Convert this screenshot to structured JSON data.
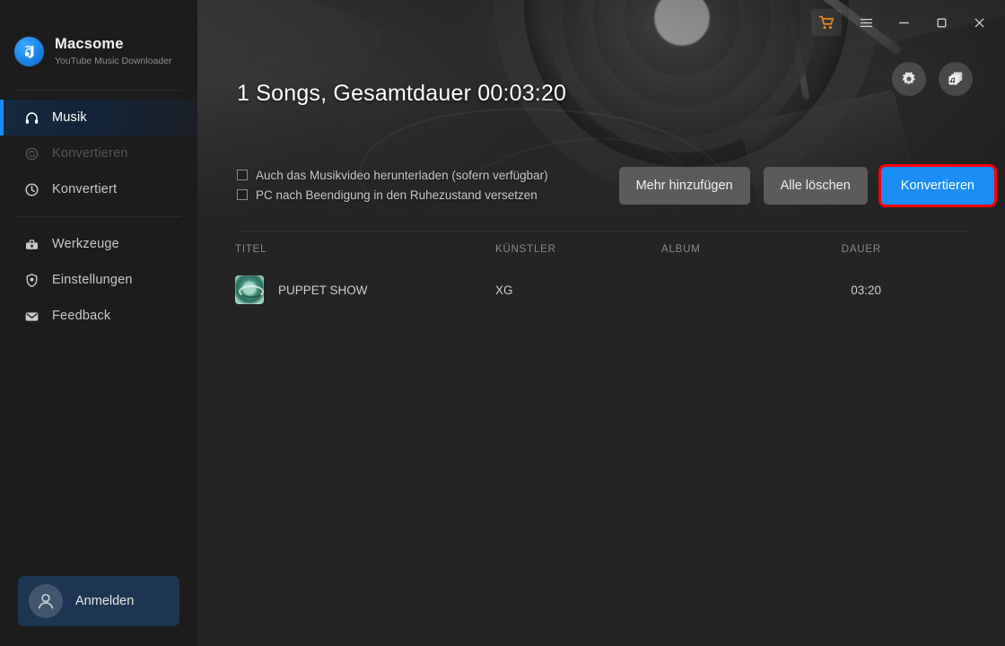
{
  "app": {
    "brand_name": "Macsome",
    "brand_subtitle": "YouTube Music Downloader",
    "logo_color": "#1c82e8",
    "accent_color": "#1a8cf5",
    "highlight_border_color": "#ff0000"
  },
  "window_controls": {
    "cart_icon": "shopping-cart-icon",
    "menu_icon": "hamburger-menu-icon",
    "minimize_icon": "minimize-icon",
    "maximize_icon": "maximize-icon",
    "close_icon": "close-icon"
  },
  "hero_tools": {
    "settings_icon": "gear-icon",
    "library_icon": "music-library-icon"
  },
  "sidebar": {
    "items": [
      {
        "label": "Musik",
        "icon": "headphones-icon",
        "state": "active"
      },
      {
        "label": "Konvertieren",
        "icon": "convert-icon",
        "state": "disabled"
      },
      {
        "label": "Konvertiert",
        "icon": "clock-history-icon",
        "state": "normal"
      },
      {
        "label": "Werkzeuge",
        "icon": "toolbox-icon",
        "state": "normal"
      },
      {
        "label": "Einstellungen",
        "icon": "settings-shield-icon",
        "state": "normal"
      },
      {
        "label": "Feedback",
        "icon": "mail-icon",
        "state": "normal"
      }
    ],
    "signin": {
      "label": "Anmelden",
      "icon": "user-avatar-icon"
    }
  },
  "main": {
    "summary": "1 Songs, Gesamtdauer 00:03:20",
    "options": [
      {
        "label": "Auch das Musikvideo herunterladen (sofern verfügbar)",
        "checked": false
      },
      {
        "label": "PC nach Beendigung in den Ruhezustand versetzen",
        "checked": false
      }
    ],
    "actions": {
      "add_more": "Mehr hinzufügen",
      "clear_all": "Alle löschen",
      "convert": "Konvertieren"
    },
    "table": {
      "columns": [
        "TITEL",
        "KÜNSTLER",
        "ALBUM",
        "DAUER"
      ],
      "rows": [
        {
          "title": "PUPPET SHOW",
          "artist": "XG",
          "album": "",
          "duration": "03:20",
          "art": "album-art-teal"
        }
      ]
    }
  }
}
